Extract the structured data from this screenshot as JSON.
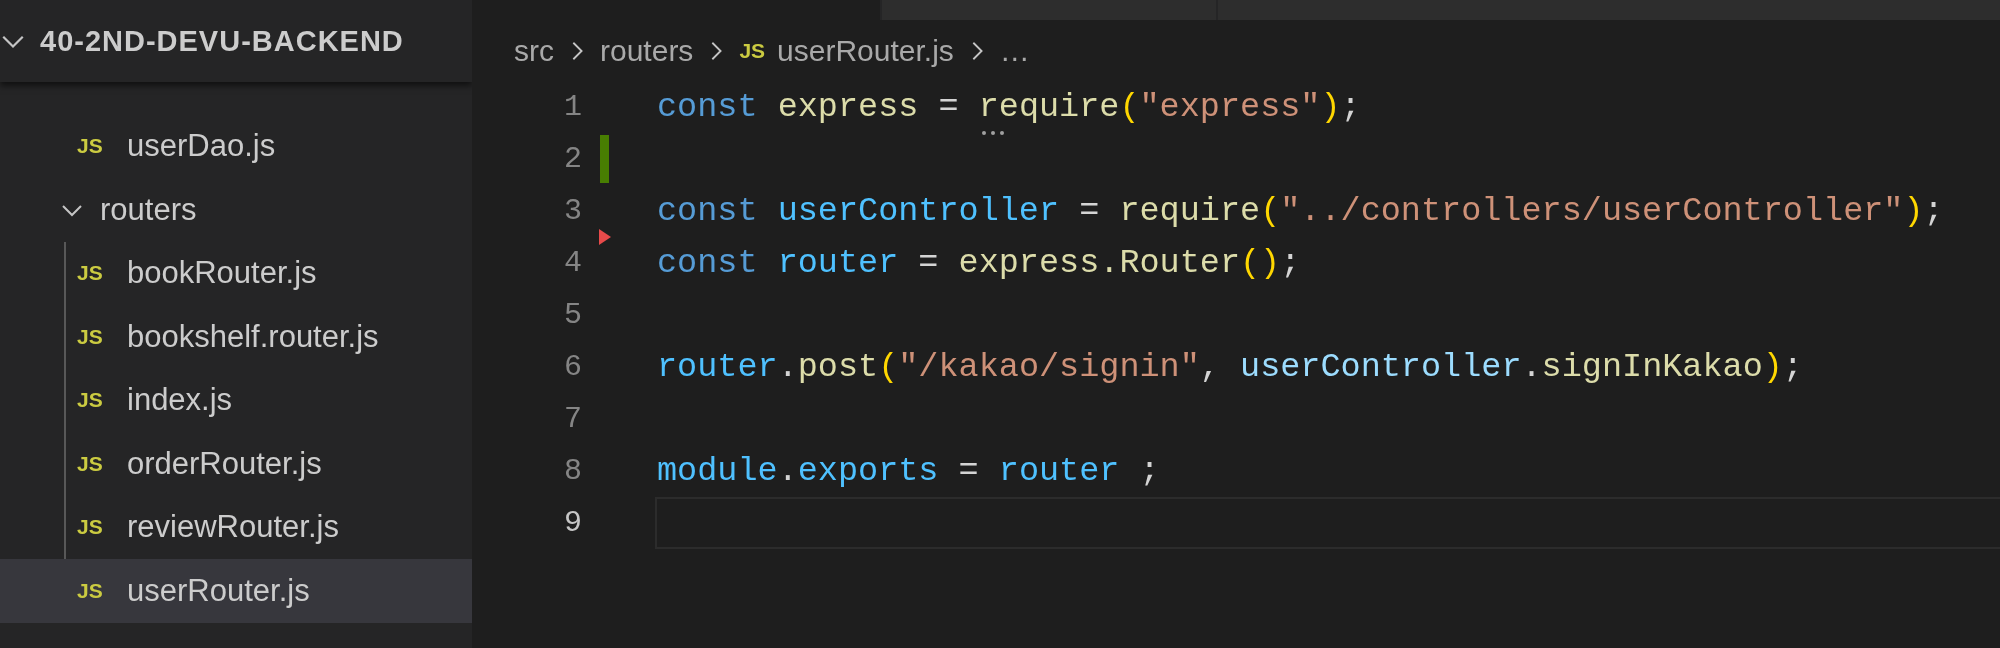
{
  "tabs": [
    {
      "selected": true
    },
    {
      "selected": false
    },
    {
      "selected": false
    }
  ],
  "explorer": {
    "title": "40-2ND-DEVU-BACKEND",
    "expanded": true,
    "items": [
      {
        "kind": "file",
        "icon": "JS",
        "name": "userDao.js",
        "modified": false,
        "selected": false
      },
      {
        "kind": "folder",
        "name": "routers",
        "expanded": true,
        "children": [
          {
            "kind": "file",
            "icon": "JS",
            "name": "bookRouter.js",
            "modified": false,
            "selected": false
          },
          {
            "kind": "file",
            "icon": "JS",
            "name": "bookshelf.router.js",
            "modified": false,
            "selected": false
          },
          {
            "kind": "file",
            "icon": "JS",
            "name": "index.js",
            "modified": false,
            "selected": false
          },
          {
            "kind": "file",
            "icon": "JS",
            "name": "orderRouter.js",
            "modified": false,
            "selected": false
          },
          {
            "kind": "file",
            "icon": "JS",
            "name": "reviewRouter.js",
            "modified": false,
            "selected": false
          },
          {
            "kind": "file",
            "icon": "JS",
            "name": "userRouter.js",
            "modified": false,
            "selected": true
          }
        ]
      }
    ]
  },
  "breadcrumbs": [
    {
      "kind": "folder",
      "label": "src"
    },
    {
      "kind": "folder",
      "label": "routers"
    },
    {
      "kind": "file",
      "icon": "JS",
      "label": "userRouter.js"
    },
    {
      "kind": "more",
      "label": "…"
    }
  ],
  "code": [
    {
      "number": "1",
      "current": false,
      "added": false,
      "deleted": false,
      "tokens": [
        {
          "kind": "keyword",
          "text": "const "
        },
        {
          "kind": "function",
          "text": "express"
        },
        {
          "kind": "plain",
          "text": " = "
        },
        {
          "kind": "function",
          "text": "require",
          "hint": true
        },
        {
          "kind": "bracket",
          "text": "("
        },
        {
          "kind": "string",
          "text": "\"express\""
        },
        {
          "kind": "bracket",
          "text": ")"
        },
        {
          "kind": "plain",
          "text": ";"
        }
      ]
    },
    {
      "number": "2",
      "current": false,
      "added": true,
      "deleted": false
    },
    {
      "number": "3",
      "current": false,
      "added": false,
      "deleted": true,
      "tokens": [
        {
          "kind": "keyword",
          "text": "const "
        },
        {
          "kind": "constant",
          "text": "userController"
        },
        {
          "kind": "plain",
          "text": " = "
        },
        {
          "kind": "function",
          "text": "require"
        },
        {
          "kind": "bracket",
          "text": "("
        },
        {
          "kind": "string",
          "text": "\"../controllers/userController\""
        },
        {
          "kind": "bracket",
          "text": ")"
        },
        {
          "kind": "plain",
          "text": ";"
        }
      ]
    },
    {
      "number": "4",
      "current": false,
      "added": false,
      "deleted": false,
      "tokens": [
        {
          "kind": "keyword",
          "text": "const "
        },
        {
          "kind": "constant",
          "text": "router"
        },
        {
          "kind": "plain",
          "text": " = "
        },
        {
          "kind": "function",
          "text": "express.Router"
        },
        {
          "kind": "bracket",
          "text": "()"
        },
        {
          "kind": "plain",
          "text": ";"
        }
      ]
    },
    {
      "number": "5",
      "current": false,
      "added": false,
      "deleted": false
    },
    {
      "number": "6",
      "current": false,
      "added": false,
      "deleted": false,
      "tokens": [
        {
          "kind": "constant",
          "text": "router"
        },
        {
          "kind": "plain",
          "text": "."
        },
        {
          "kind": "function",
          "text": "post"
        },
        {
          "kind": "bracket",
          "text": "("
        },
        {
          "kind": "string",
          "text": "\"/kakao/signin\""
        },
        {
          "kind": "plain",
          "text": ", "
        },
        {
          "kind": "variable",
          "text": "userController"
        },
        {
          "kind": "plain",
          "text": "."
        },
        {
          "kind": "function",
          "text": "signInKakao"
        },
        {
          "kind": "bracket",
          "text": ")"
        },
        {
          "kind": "plain",
          "text": ";"
        }
      ]
    },
    {
      "number": "7",
      "current": false,
      "added": false,
      "deleted": false
    },
    {
      "number": "8",
      "current": false,
      "added": false,
      "deleted": false,
      "tokens": [
        {
          "kind": "constant",
          "text": "module"
        },
        {
          "kind": "plain",
          "text": "."
        },
        {
          "kind": "constant",
          "text": "exports"
        },
        {
          "kind": "plain",
          "text": " = "
        },
        {
          "kind": "constant",
          "text": "router"
        },
        {
          "kind": "plain",
          "text": " ;"
        }
      ]
    },
    {
      "number": "9",
      "current": true,
      "added": false,
      "deleted": false
    }
  ]
}
